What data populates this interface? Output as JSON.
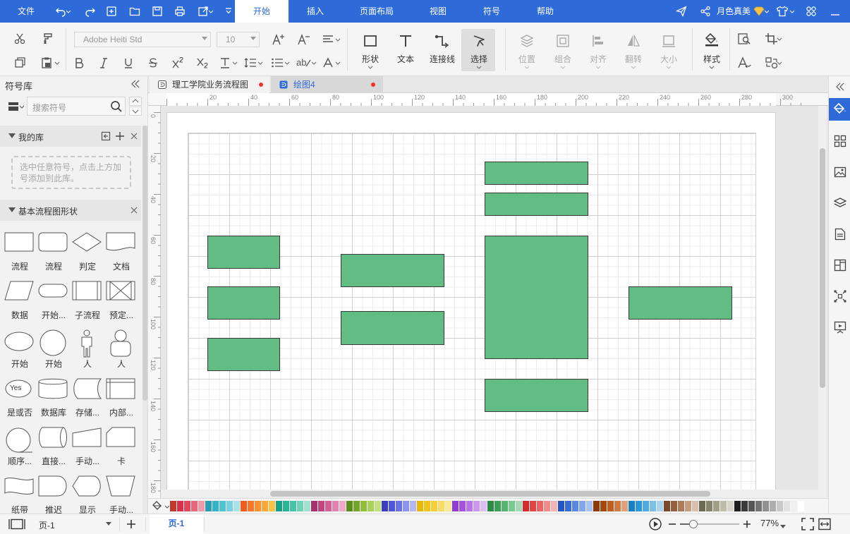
{
  "menubar": {
    "file": "文件",
    "tabs": [
      "开始",
      "插入",
      "页面布局",
      "视图",
      "符号",
      "帮助"
    ],
    "active_tab": "开始",
    "user_name": "月色真美",
    "accent": "#2e6bd8"
  },
  "toolbar": {
    "font_family": "Adobe Heiti Std",
    "font_size": "10",
    "tools": {
      "shape": "形状",
      "text": "文本",
      "connector": "连接线",
      "select": "选择",
      "position": "位置",
      "group": "组合",
      "align": "对齐",
      "flip": "翻转",
      "size": "大小",
      "style": "样式"
    }
  },
  "library": {
    "title": "符号库",
    "search_placeholder": "搜索符号",
    "my_library": "我的库",
    "my_library_hint": "选中任意符号，点击上方加号添加到此库。",
    "basic_section": "基本流程图形状",
    "shapes": [
      "流程",
      "流程",
      "判定",
      "文档",
      "数据",
      "开始...",
      "子流程",
      "预定...",
      "开始",
      "开始",
      "人",
      "人",
      "是或否",
      "数据库",
      "存储...",
      "内部...",
      "顺序...",
      "直接...",
      "手动...",
      "卡",
      "纸带",
      "推迟",
      "显示",
      "手动..."
    ],
    "yes_text": "Yes"
  },
  "documents": {
    "tabs": [
      {
        "name": "理工学院业务流程图",
        "unsaved": true
      },
      {
        "name": "绘图4",
        "unsaved": true
      }
    ]
  },
  "rulers": {
    "top": [
      "20",
      "40",
      "60",
      "80",
      "100",
      "120",
      "140",
      "160",
      "180",
      "200",
      "220",
      "240",
      "260",
      "280",
      "300"
    ],
    "left": [
      "0",
      "20",
      "40",
      "60",
      "80",
      "100",
      "120",
      "140",
      "160",
      "180"
    ]
  },
  "diagram": {
    "fill_color": "#62bd84",
    "border_color": "#3a3a3a"
  },
  "statusbar": {
    "page_select": "页-1",
    "page_tab": "页-1",
    "zoom": "77%"
  }
}
